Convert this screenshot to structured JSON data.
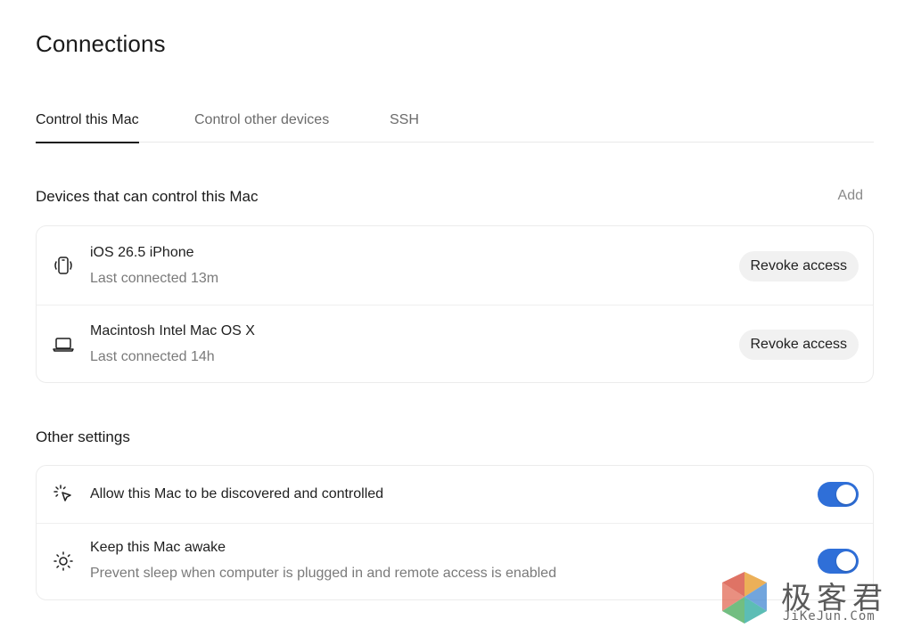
{
  "page": {
    "title": "Connections"
  },
  "tabs": [
    {
      "label": "Control this Mac",
      "active": true
    },
    {
      "label": "Control other devices",
      "active": false
    },
    {
      "label": "SSH",
      "active": false
    }
  ],
  "devices_section": {
    "title": "Devices that can control this Mac",
    "add_label": "Add",
    "devices": [
      {
        "icon": "phone-icon",
        "name": "iOS 26.5 iPhone",
        "last_connected": "Last connected 13m",
        "action_label": "Revoke access"
      },
      {
        "icon": "laptop-icon",
        "name": "Macintosh Intel Mac OS X",
        "last_connected": "Last connected 14h",
        "action_label": "Revoke access"
      }
    ]
  },
  "other_settings": {
    "title": "Other settings",
    "items": [
      {
        "icon": "cursor-click-icon",
        "label": "Allow this Mac to be discovered and controlled",
        "description": "",
        "enabled": true
      },
      {
        "icon": "sun-icon",
        "label": "Keep this Mac awake",
        "description": "Prevent sleep when computer is plugged in and remote access is enabled",
        "enabled": true
      }
    ]
  },
  "watermark": {
    "text": "极客君",
    "sub": "JiKeJun.Com"
  },
  "colors": {
    "accent": "#2f6fd8",
    "text": "#1f1f1f",
    "muted": "#7a7a7a",
    "pill_bg": "#f1f1f1"
  }
}
